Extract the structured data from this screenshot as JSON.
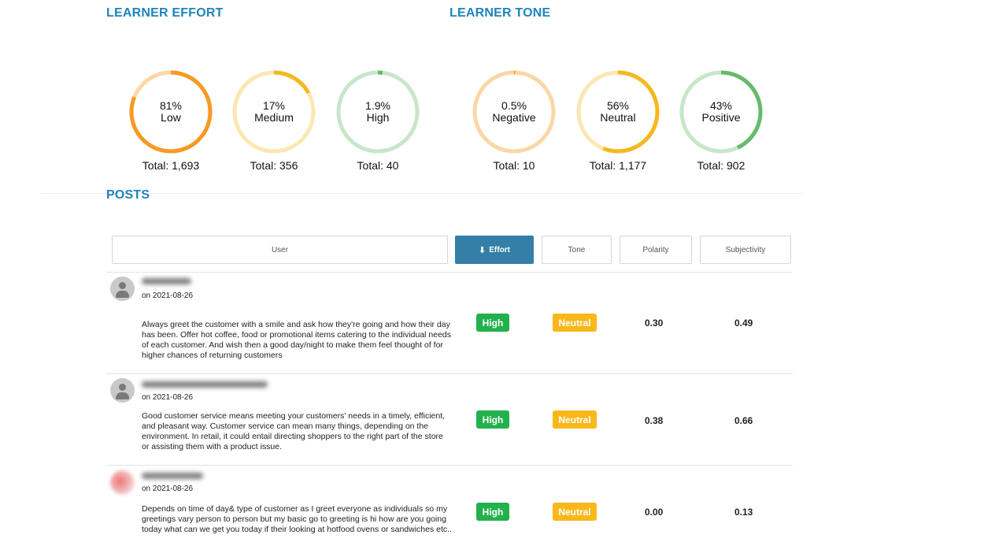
{
  "effort": {
    "title": "LEARNER EFFORT",
    "items": [
      {
        "pct_label": "81%",
        "name": "Low",
        "total": "Total: 1,693",
        "fraction": 0.81,
        "color": "#f59a23",
        "track": "#fbd7a8"
      },
      {
        "pct_label": "17%",
        "name": "Medium",
        "total": "Total: 356",
        "fraction": 0.17,
        "color": "#f5b81f",
        "track": "#fce7b2"
      },
      {
        "pct_label": "1.9%",
        "name": "High",
        "total": "Total: 40",
        "fraction": 0.019,
        "color": "#66bb6a",
        "track": "#c8e6c9"
      }
    ]
  },
  "tone": {
    "title": "LEARNER TONE",
    "items": [
      {
        "pct_label": "0.5%",
        "name": "Negative",
        "total": "Total: 10",
        "fraction": 0.005,
        "color": "#f59a23",
        "track": "#fbd7a8"
      },
      {
        "pct_label": "56%",
        "name": "Neutral",
        "total": "Total: 1,177",
        "fraction": 0.56,
        "color": "#f5b81f",
        "track": "#fce7b2"
      },
      {
        "pct_label": "43%",
        "name": "Positive",
        "total": "Total: 902",
        "fraction": 0.43,
        "color": "#66bb6a",
        "track": "#c8e6c9"
      }
    ]
  },
  "posts": {
    "title": "POSTS",
    "columns": {
      "user": "User",
      "effort": "Effort",
      "tone": "Tone",
      "polarity": "Polarity",
      "subjectivity": "Subjectivity"
    },
    "rows": [
      {
        "date": "on 2021-08-26",
        "text": "Always greet the customer with a smile and ask how they're going and how their day has been. Offer hot coffee, food or promotional items catering to the individual needs of each customer. And wish then a good day/night to make them feel thought of for higher chances of returning customers",
        "effort": "High",
        "tone": "Neutral",
        "polarity": "0.30",
        "subjectivity": "0.49"
      },
      {
        "date": "on 2021-08-26",
        "text": "Good customer service means meeting your customers' needs in a timely, efficient, and pleasant way. Customer service can mean many things, depending on the environment. In retail, it could entail directing shoppers to the right part of the store or assisting them with a product issue.",
        "effort": "High",
        "tone": "Neutral",
        "polarity": "0.38",
        "subjectivity": "0.66"
      },
      {
        "date": "on 2021-08-26",
        "text": "Depends on time of day& type of customer as I greet everyone as individuals so my greetings vary person to person but my basic go to greeting is hi how are you going today what can we get you today if their looking at hotfood ovens or sandwiches etc..",
        "effort": "High",
        "tone": "Neutral",
        "polarity": "0.00",
        "subjectivity": "0.13"
      }
    ]
  },
  "icons": {
    "sort": "arrow-down-icon",
    "avatar": "user-avatar-icon"
  },
  "colors": {
    "title_blue": "#1f84b8",
    "active_header": "#337fa8",
    "badge_green": "#22b14c",
    "badge_amber": "#f9b81a"
  }
}
